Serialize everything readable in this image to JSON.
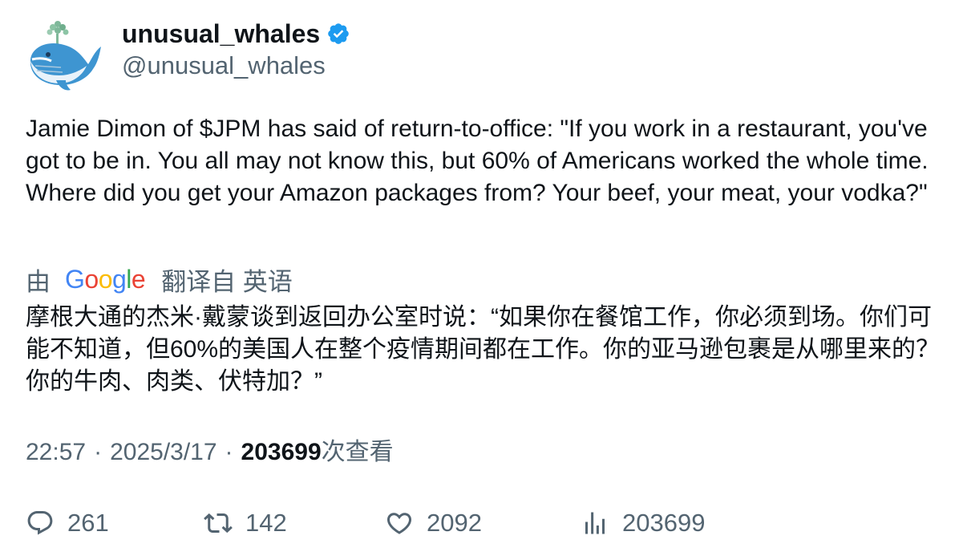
{
  "user": {
    "display_name": "unusual_whales",
    "handle": "@unusual_whales"
  },
  "tweet": {
    "text": "Jamie Dimon of $JPM has said of return-to-office: \"If you work in a restaurant, you've got to be in. You all may not know this, but 60% of Americans worked the whole time. Where did you get your Amazon packages from? Your beef, your meat, your vodka?\""
  },
  "translation": {
    "by_label": "由",
    "provider": "Google",
    "from_label": "翻译自 英语",
    "text": "摩根大通的杰米·戴蒙谈到返回办公室时说：“如果你在餐馆工作，你必须到场。你们可能不知道，但60%的美国人在整个疫情期间都在工作。你的亚马逊包裹是从哪里来的？你的牛肉、肉类、伏特加？”"
  },
  "meta": {
    "time": "22:57",
    "separator": "·",
    "date": "2025/3/17",
    "views_count": "203699",
    "views_label": "次查看"
  },
  "actions": {
    "replies": "261",
    "retweets": "142",
    "likes": "2092",
    "views": "203699"
  },
  "colors": {
    "text_primary": "#0f1419",
    "text_secondary": "#536471",
    "verified": "#1d9bf0",
    "google_blue": "#4285F4",
    "google_red": "#EA4335",
    "google_yellow": "#FBBC05",
    "google_green": "#34A853"
  }
}
